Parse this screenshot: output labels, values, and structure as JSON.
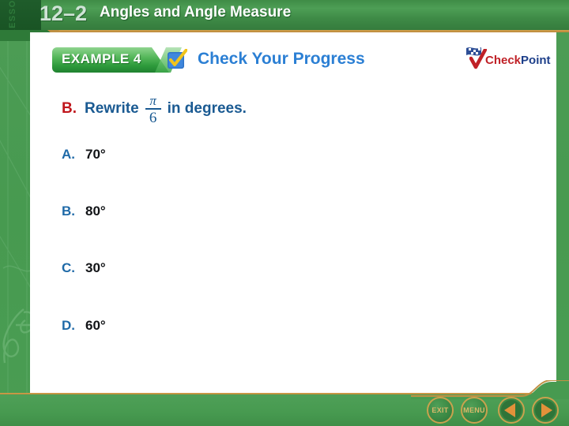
{
  "header": {
    "lesson_word": "LESSON",
    "lesson_number": "12–2",
    "lesson_title": "Angles and Angle Measure"
  },
  "example_bar": {
    "example_label": "EXAMPLE 4",
    "check_icon": "blue-checkbox-icon",
    "check_your_progress": "Check Your Progress"
  },
  "checkpoint_logo": {
    "check_word": "Check",
    "point_word": "Point",
    "flag_icon": "checkered-flag-icon",
    "tick_icon": "red-checkmark-icon"
  },
  "question": {
    "letter": "B.",
    "text_before": "Rewrite",
    "fraction_numerator": "π",
    "fraction_denominator": "6",
    "text_after": "in degrees."
  },
  "choices": [
    {
      "letter": "A.",
      "value": "70°"
    },
    {
      "letter": "B.",
      "value": "80°"
    },
    {
      "letter": "C.",
      "value": "30°"
    },
    {
      "letter": "D.",
      "value": "60°"
    }
  ],
  "nav": {
    "exit_label": "EXIT",
    "menu_label": "MENU",
    "prev_icon": "left-arrow-icon",
    "next_icon": "right-arrow-icon"
  },
  "colors": {
    "header_green": "#3f8c46",
    "panel_white": "#ffffff",
    "gold_rule": "#c09043",
    "question_blue": "#1a5a92",
    "question_letter_red": "#c0161c",
    "choice_letter_blue": "#1f6aa8",
    "choice_value_black": "#111316",
    "cyp_blue": "#2b7fd4",
    "checkpoint_red": "#c02127",
    "checkpoint_navy": "#1d3f8a",
    "bottom_bar_green": "#479a50"
  }
}
